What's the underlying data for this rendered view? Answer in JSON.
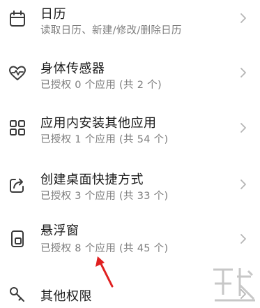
{
  "permissions": [
    {
      "icon": "calendar-icon",
      "title": "日历",
      "subtitle": "读取日历、新建/修改/删除日历"
    },
    {
      "icon": "heart-pulse-icon",
      "title": "身体传感器",
      "subtitle": "已授权 0 个应用 (共 2 个)"
    },
    {
      "icon": "apps-grid-icon",
      "title": "应用内安装其他应用",
      "subtitle": "已授权 1 个应用 (共 54 个)"
    },
    {
      "icon": "shortcut-share-icon",
      "title": "创建桌面快捷方式",
      "subtitle": "已授权 3 个应用 (共 33 个)"
    },
    {
      "icon": "floating-window-icon",
      "title": "悬浮窗",
      "subtitle": "已授权 8 个应用 (共 45 个)"
    },
    {
      "icon": "key-icon",
      "title": "其他权限",
      "subtitle": ""
    }
  ],
  "colors": {
    "title": "#1a1a1a",
    "subtitle": "#7d7d7d",
    "icon": "#3a3a3a",
    "chevron": "#b5b5b5",
    "annotation": "#e02020"
  }
}
